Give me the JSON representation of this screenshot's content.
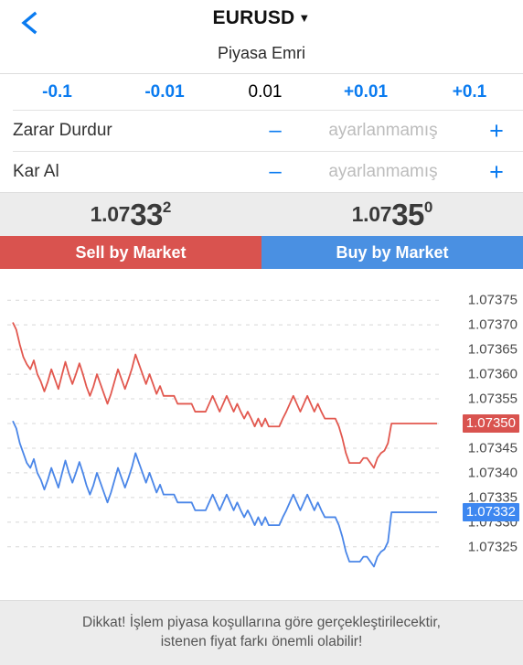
{
  "header": {
    "back_icon": "chevron-left-icon",
    "symbol": "EURUSD",
    "caret": "▼",
    "subtitle": "Piyasa Emri"
  },
  "volume_stepper": {
    "decrement_large": "-0.1",
    "decrement_small": "-0.01",
    "value": "0.01",
    "increment_small": "+0.01",
    "increment_large": "+0.1"
  },
  "orders": [
    {
      "label": "Zarar Durdur",
      "minus": "–",
      "value": "ayarlanmamış",
      "plus": "+"
    },
    {
      "label": "Kar Al",
      "minus": "–",
      "value": "ayarlanmamış",
      "plus": "+"
    }
  ],
  "quotes": {
    "bid": {
      "prefix": "1.07",
      "big": "33",
      "sup": "2"
    },
    "ask": {
      "prefix": "1.07",
      "big": "35",
      "sup": "0"
    }
  },
  "actions": {
    "sell_label": "Sell by Market",
    "buy_label": "Buy by Market",
    "sell_color": "#d9534f",
    "buy_color": "#4a90e2"
  },
  "footer": {
    "line1": "Dikkat! İşlem piyasa koşullarına göre gerçekleştirilecektir,",
    "line2": "istenen fiyat farkı önemli olabilir!"
  },
  "chart_data": {
    "type": "line",
    "title": "",
    "xlabel": "",
    "ylabel": "",
    "grid": true,
    "legend": null,
    "ylim": [
      1.07322,
      1.07378
    ],
    "yticks": [
      "1.07375",
      "1.07370",
      "1.07365",
      "1.07360",
      "1.07355",
      "1.07350",
      "1.07345",
      "1.07340",
      "1.07335",
      "1.07330",
      "1.07325"
    ],
    "ytick_values": [
      1.07375,
      1.0737,
      1.07365,
      1.0736,
      1.07355,
      1.0735,
      1.07345,
      1.0734,
      1.07335,
      1.0733,
      1.07325
    ],
    "price_labels": [
      {
        "name": "ask",
        "text": "1.07350",
        "value": 1.0735,
        "color": "#d9534f"
      },
      {
        "name": "bid",
        "text": "1.07332",
        "value": 1.07332,
        "color": "#3d87f0"
      }
    ],
    "series": [
      {
        "name": "ask",
        "color": "#e2584f",
        "values": [
          1.073705,
          1.07369,
          1.07366,
          1.073635,
          1.07362,
          1.07361,
          1.073628,
          1.0736,
          1.073585,
          1.073565,
          1.073585,
          1.07361,
          1.07359,
          1.07357,
          1.073598,
          1.073625,
          1.0736,
          1.07358,
          1.0736,
          1.073622,
          1.0736,
          1.073575,
          1.073556,
          1.073575,
          1.0736,
          1.07358,
          1.07356,
          1.07354,
          1.07356,
          1.073585,
          1.07361,
          1.07359,
          1.07357,
          1.07359,
          1.073612,
          1.07364,
          1.07362,
          1.0736,
          1.07358,
          1.0736,
          1.07358,
          1.07356,
          1.073576,
          1.073556,
          1.073556,
          1.073556,
          1.073556,
          1.07354,
          1.07354,
          1.07354,
          1.07354,
          1.07354,
          1.073524,
          1.073524,
          1.073524,
          1.073524,
          1.07354,
          1.073556,
          1.07354,
          1.073524,
          1.07354,
          1.073556,
          1.07354,
          1.073524,
          1.07354,
          1.073524,
          1.07351,
          1.073524,
          1.07351,
          1.073494,
          1.07351,
          1.073494,
          1.07351,
          1.073494,
          1.073494,
          1.073494,
          1.073494,
          1.07351,
          1.073524,
          1.07354,
          1.073556,
          1.07354,
          1.073524,
          1.07354,
          1.073556,
          1.07354,
          1.073524,
          1.07354,
          1.073524,
          1.07351,
          1.07351,
          1.07351,
          1.07351,
          1.073494,
          1.07347,
          1.07344,
          1.07342,
          1.07342,
          1.07342,
          1.07342,
          1.07343,
          1.07343,
          1.07342,
          1.07341,
          1.07343,
          1.07344,
          1.073445,
          1.07346,
          1.0735,
          1.0735,
          1.0735,
          1.0735,
          1.0735,
          1.0735,
          1.0735,
          1.0735,
          1.0735,
          1.0735,
          1.0735,
          1.0735,
          1.0735,
          1.0735
        ]
      },
      {
        "name": "bid",
        "color": "#4a86e8",
        "values": [
          1.073505,
          1.07349,
          1.07346,
          1.07344,
          1.07342,
          1.07341,
          1.073428,
          1.0734,
          1.073386,
          1.073366,
          1.073386,
          1.07341,
          1.07339,
          1.07337,
          1.073398,
          1.073425,
          1.0734,
          1.07338,
          1.0734,
          1.073422,
          1.0734,
          1.073375,
          1.073356,
          1.073375,
          1.0734,
          1.07338,
          1.07336,
          1.07334,
          1.07336,
          1.073385,
          1.07341,
          1.07339,
          1.07337,
          1.07339,
          1.073412,
          1.07344,
          1.07342,
          1.0734,
          1.07338,
          1.0734,
          1.07338,
          1.07336,
          1.073376,
          1.073356,
          1.073356,
          1.073356,
          1.073356,
          1.07334,
          1.07334,
          1.07334,
          1.07334,
          1.07334,
          1.073324,
          1.073324,
          1.073324,
          1.073324,
          1.07334,
          1.073356,
          1.07334,
          1.073324,
          1.07334,
          1.073356,
          1.07334,
          1.073324,
          1.07334,
          1.073324,
          1.07331,
          1.073324,
          1.07331,
          1.073294,
          1.07331,
          1.073294,
          1.07331,
          1.073294,
          1.073294,
          1.073294,
          1.073294,
          1.07331,
          1.073324,
          1.07334,
          1.073356,
          1.07334,
          1.073324,
          1.07334,
          1.073356,
          1.07334,
          1.073324,
          1.07334,
          1.073324,
          1.07331,
          1.07331,
          1.07331,
          1.07331,
          1.073294,
          1.07327,
          1.07324,
          1.07322,
          1.07322,
          1.07322,
          1.07322,
          1.07323,
          1.07323,
          1.07322,
          1.07321,
          1.07323,
          1.07324,
          1.073245,
          1.07326,
          1.07332,
          1.07332,
          1.07332,
          1.07332,
          1.07332,
          1.07332,
          1.07332,
          1.07332,
          1.07332,
          1.07332,
          1.07332,
          1.07332,
          1.07332,
          1.07332
        ]
      }
    ]
  }
}
